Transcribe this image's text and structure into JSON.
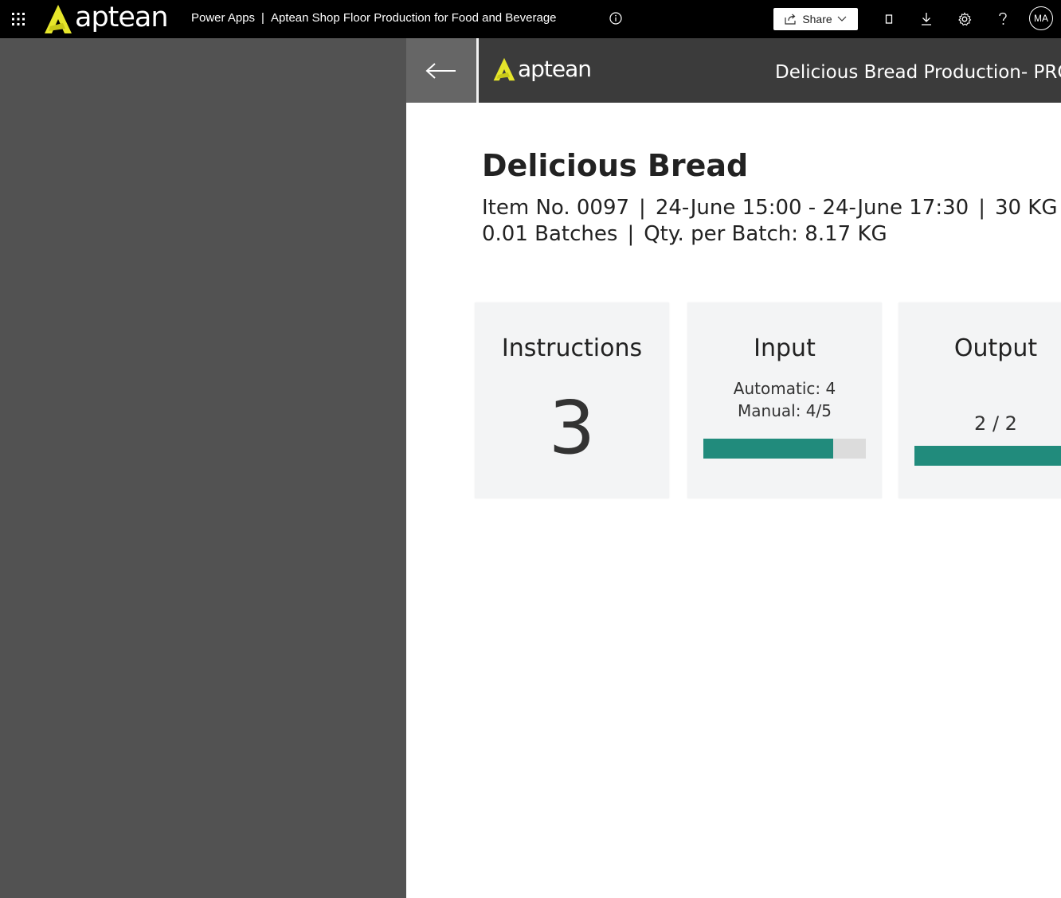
{
  "topbar": {
    "brand": "aptean",
    "app_name": "Power Apps",
    "separator": "|",
    "app_title": "Aptean Shop Floor Production for Food and Beverage",
    "share_label": "Share",
    "avatar_initials": "MA",
    "icons": [
      "waffle-icon",
      "info-icon",
      "share-icon",
      "chevron-down-icon",
      "mobile-icon",
      "download-icon",
      "settings-icon",
      "help-icon"
    ]
  },
  "app": {
    "brand": "aptean",
    "header_title": "Delicious Bread Production- PRO",
    "colors": {
      "header": "#3b3b3b",
      "back": "#666666",
      "accent": "#218b7c",
      "logo": "#e6e62b"
    }
  },
  "item": {
    "title": "Delicious Bread",
    "item_no": "Item No. 0097",
    "period": "24-June 15:00 - 24-June 17:30",
    "quantity": "30 KG",
    "batches": "0.01 Batches",
    "qty_per_batch": "Qty. per Batch: 8.17 KG",
    "pipe": "|"
  },
  "cards": {
    "instructions": {
      "title": "Instructions",
      "count": "3"
    },
    "input": {
      "title": "Input",
      "automatic": "Automatic: 4",
      "manual": "Manual: 4/5",
      "progress": 0.8
    },
    "output": {
      "title": "Output",
      "ratio": "2 / 2",
      "progress": 1.0
    }
  }
}
